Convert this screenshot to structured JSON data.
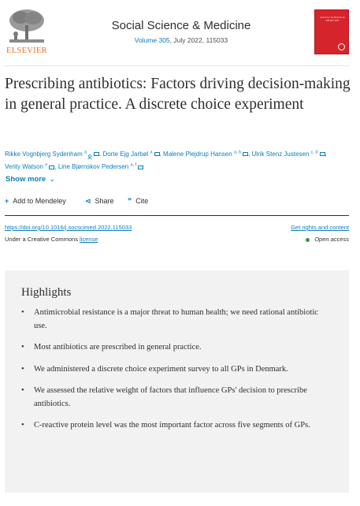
{
  "header": {
    "publisher": "ELSEVIER",
    "journal": "Social Science & Medicine",
    "volume_link": "Volume 305",
    "volume_rest": ", July 2022, 115033",
    "cover_text": "SOCIAL SCIENCE & MEDICINE",
    "colors": {
      "publisher_orange": "#e9711c",
      "cover_red": "#d6242c",
      "link_blue": "#0c7dbb"
    }
  },
  "article": {
    "title": "Prescribing antibiotics: Factors driving decision-making in general practice. A discrete choice experiment",
    "authors": [
      {
        "name": "Rikke Vognbjerg Sydenham",
        "sup": "a",
        "icons": [
          "person-icon",
          "mail-icon"
        ]
      },
      {
        "name": "Dorte Ejg Jarbøl",
        "sup": "a",
        "icons": [
          "mail-icon"
        ]
      },
      {
        "name": "Malene Plejdrup Hansen",
        "sup": "a, b",
        "icons": [
          "mail-icon"
        ]
      },
      {
        "name": "Ulrik Stenz Justesen",
        "sup": "c, d",
        "icons": [
          "mail-icon"
        ]
      },
      {
        "name": "Verity Watson",
        "sup": "e",
        "icons": [
          "mail-icon"
        ]
      },
      {
        "name": "Line Bjørnskov Pedersen",
        "sup": "a, f",
        "icons": [
          "mail-icon"
        ]
      }
    ],
    "show_more": "Show more",
    "actions": {
      "mendeley": "Add to Mendeley",
      "share": "Share",
      "cite": "Cite"
    },
    "doi": "https://doi.org/10.1016/j.socscimed.2022.115033",
    "rights": "Get rights and content",
    "cc_prefix": "Under a Creative Commons ",
    "cc_link": "license",
    "open_access": "Open access"
  },
  "highlights": {
    "heading": "Highlights",
    "items": [
      "Antimicrobial resistance is a major threat to human health; we need rational antibiotic use.",
      "Most antibiotics are prescribed in general practice.",
      "We administered a discrete choice experiment survey to all GPs in Denmark.",
      "We assessed the relative weight of factors that influence GPs' decision to prescribe antibiotics.",
      "C-reactive protein level was the most important factor across five segments of GPs."
    ]
  }
}
